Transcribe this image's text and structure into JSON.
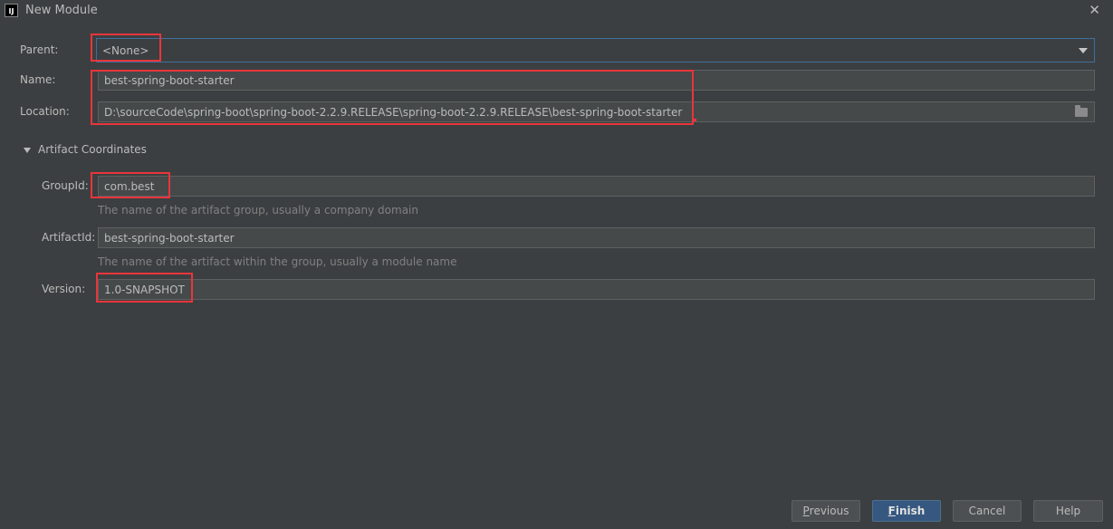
{
  "window": {
    "app_icon_text": "IJ",
    "title": "New Module",
    "close_glyph": "✕"
  },
  "form": {
    "parent_label": "Parent:",
    "parent_value": "<None>",
    "name_label": "Name:",
    "name_value": "best-spring-boot-starter",
    "location_label": "Location:",
    "location_value": "D:\\sourceCode\\spring-boot\\spring-boot-2.2.9.RELEASE\\spring-boot-2.2.9.RELEASE\\best-spring-boot-starter"
  },
  "artifact": {
    "section_title": "Artifact Coordinates",
    "groupid_label": "GroupId:",
    "groupid_value": "com.best",
    "groupid_hint": "The name of the artifact group, usually a company domain",
    "artifactid_label": "ArtifactId:",
    "artifactid_value": "best-spring-boot-starter",
    "artifactid_hint": "The name of the artifact within the group, usually a module name",
    "version_label": "Version:",
    "version_value": "1.0-SNAPSHOT"
  },
  "buttons": {
    "previous_mnemonic": "P",
    "previous_rest": "revious",
    "finish_mnemonic": "F",
    "finish_rest": "inish",
    "cancel": "Cancel",
    "help": "Help"
  },
  "colors": {
    "background": "#3c3f41",
    "field_background": "#45494a",
    "highlight_red": "#e8353b",
    "primary_button": "#365880",
    "focus_border": "#3f6e9b"
  },
  "icons": {
    "app": "intellij-icon",
    "close": "close-icon",
    "dropdown": "chevron-down-icon",
    "browse": "folder-icon",
    "section": "expand-arrow-icon"
  }
}
